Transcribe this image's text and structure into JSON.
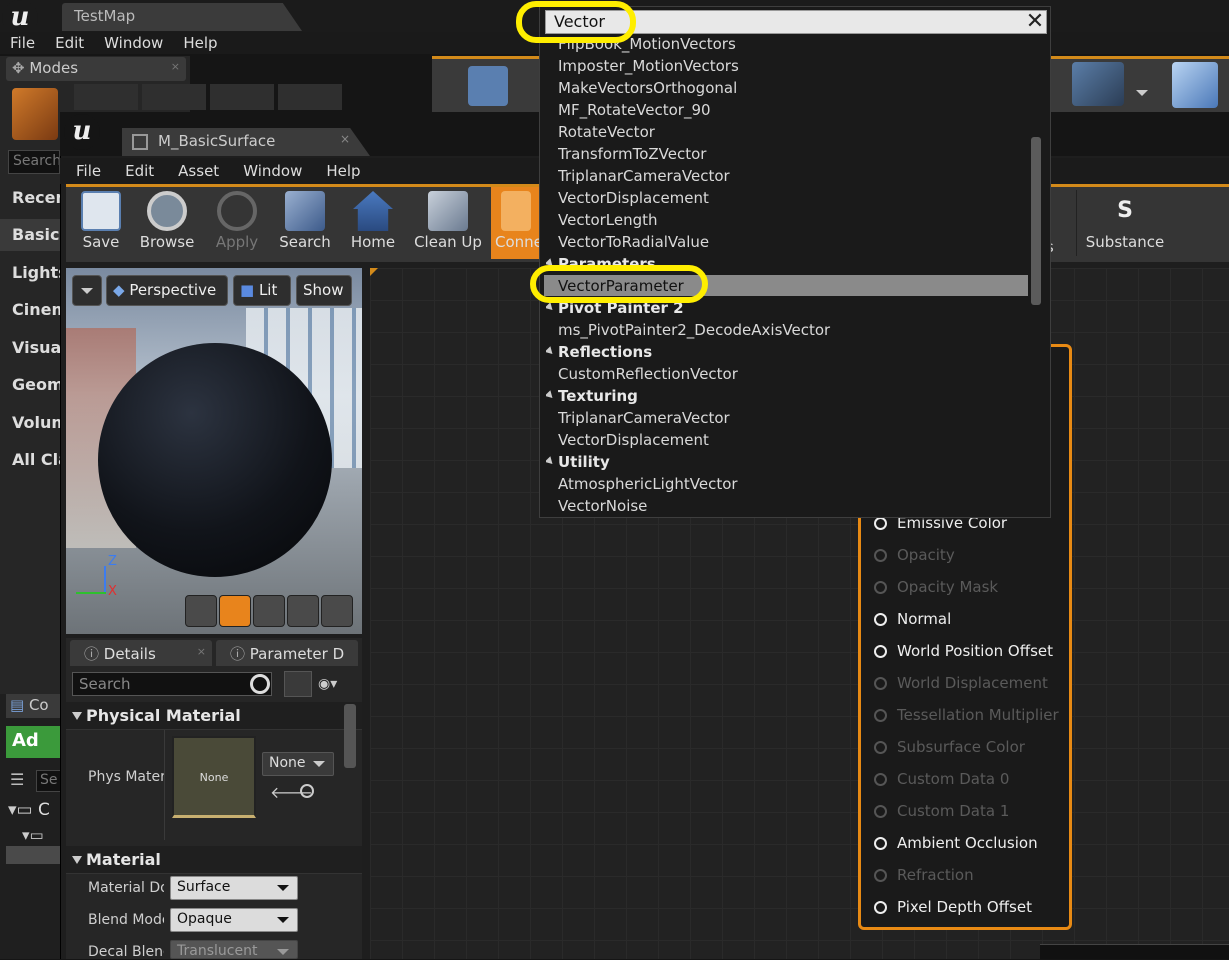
{
  "outer": {
    "tab_title": "TestMap",
    "menu": [
      "File",
      "Edit",
      "Window",
      "Help"
    ],
    "modes_tab": "Modes",
    "search_placeholder": "Search",
    "categories": [
      "Recen",
      "Basic",
      "Lights",
      "Cinem",
      "Visual",
      "Geom",
      "Volum",
      "All Cla"
    ],
    "content_tab": "Co",
    "add_new": "Ad",
    "folder_c": "C",
    "search_short": "Se"
  },
  "mat": {
    "tab_title": "M_BasicSurface",
    "menu": [
      "File",
      "Edit",
      "Asset",
      "Window",
      "Help"
    ],
    "toolbar": {
      "save": "Save",
      "browse": "Browse",
      "apply": "Apply",
      "search": "Search",
      "home": "Home",
      "cleanup": "Clean Up",
      "connectors": "Conne",
      "stats_partial": "ts",
      "substance": "Substance"
    },
    "viewport": {
      "perspective": "Perspective",
      "lit": "Lit",
      "show": "Show",
      "axis_z": "Z",
      "axis_x": "X"
    },
    "details": {
      "tab_details": "Details",
      "tab_params": "Parameter D",
      "search_placeholder": "Search",
      "physical_material_header": "Physical Material",
      "phys_mat_label": "Phys Mater",
      "phys_thumb_label": "None",
      "phys_combo": "None",
      "material_header": "Material",
      "material_domain_label": "Material Do",
      "material_domain_value": "Surface",
      "blend_mode_label": "Blend Mode",
      "blend_mode_value": "Opaque",
      "decal_blend_label": "Decal Blenc",
      "decal_blend_value": "Translucent"
    }
  },
  "node_pins": [
    {
      "label": "Emissive Color",
      "enabled": true
    },
    {
      "label": "Opacity",
      "enabled": false
    },
    {
      "label": "Opacity Mask",
      "enabled": false
    },
    {
      "label": "Normal",
      "enabled": true
    },
    {
      "label": "World Position Offset",
      "enabled": true
    },
    {
      "label": "World Displacement",
      "enabled": false
    },
    {
      "label": "Tessellation Multiplier",
      "enabled": false
    },
    {
      "label": "Subsurface Color",
      "enabled": false
    },
    {
      "label": "Custom Data 0",
      "enabled": false
    },
    {
      "label": "Custom Data 1",
      "enabled": false
    },
    {
      "label": "Ambient Occlusion",
      "enabled": true
    },
    {
      "label": "Refraction",
      "enabled": false
    },
    {
      "label": "Pixel Depth Offset",
      "enabled": true
    }
  ],
  "popup": {
    "search_value": "Vector",
    "close": "✕",
    "rows": [
      {
        "kind": "item",
        "text": "FlipBook_MotionVectors"
      },
      {
        "kind": "item",
        "text": "Imposter_MotionVectors"
      },
      {
        "kind": "item",
        "text": "MakeVectorsOrthogonal"
      },
      {
        "kind": "item",
        "text": "MF_RotateVector_90"
      },
      {
        "kind": "item",
        "text": "RotateVector"
      },
      {
        "kind": "item",
        "text": "TransformToZVector"
      },
      {
        "kind": "item",
        "text": "TriplanarCameraVector"
      },
      {
        "kind": "item",
        "text": "VectorDisplacement"
      },
      {
        "kind": "item",
        "text": "VectorLength"
      },
      {
        "kind": "item",
        "text": "VectorToRadialValue"
      },
      {
        "kind": "cat",
        "text": "Parameters"
      },
      {
        "kind": "item",
        "text": "VectorParameter",
        "selected": true
      },
      {
        "kind": "cat",
        "text": "Pivot Painter 2"
      },
      {
        "kind": "item",
        "text": "ms_PivotPainter2_DecodeAxisVector"
      },
      {
        "kind": "cat",
        "text": "Reflections"
      },
      {
        "kind": "item",
        "text": "CustomReflectionVector"
      },
      {
        "kind": "cat",
        "text": "Texturing"
      },
      {
        "kind": "item",
        "text": "TriplanarCameraVector"
      },
      {
        "kind": "item",
        "text": "VectorDisplacement"
      },
      {
        "kind": "cat",
        "text": "Utility"
      },
      {
        "kind": "item",
        "text": "AtmosphericLightVector"
      },
      {
        "kind": "item",
        "text": "VectorNoise"
      }
    ]
  },
  "colors": {
    "accent_orange": "#e88a14",
    "highlight_yellow": "#ffee00",
    "selected_row": "#8a8a8a"
  }
}
